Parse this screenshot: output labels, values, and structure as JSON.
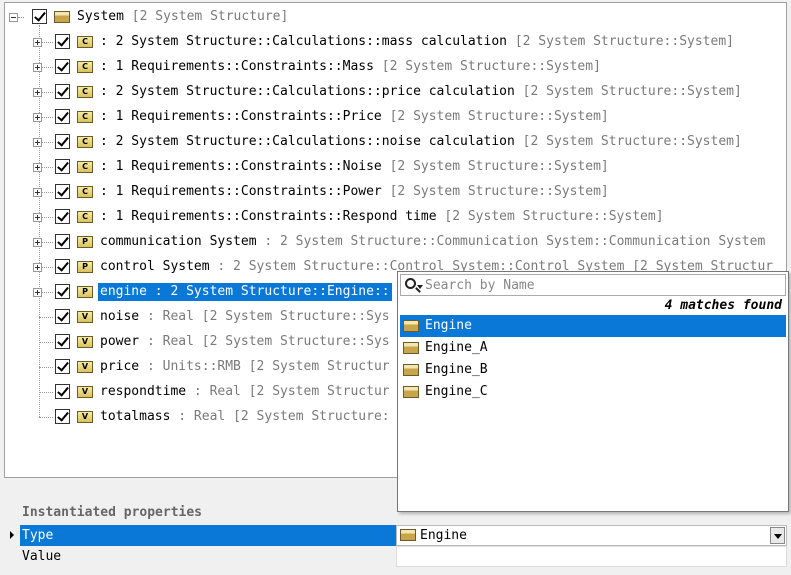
{
  "tree": {
    "root": {
      "name": "System",
      "meta": "[2 System Structure]"
    },
    "items": [
      {
        "icon": "C",
        "name": ": 2 System Structure::Calculations::mass calculation",
        "meta": "[2 System Structure::System]"
      },
      {
        "icon": "C",
        "name": ": 1 Requirements::Constraints::Mass",
        "meta": "[2 System Structure::System]"
      },
      {
        "icon": "C",
        "name": ": 2 System Structure::Calculations::price calculation",
        "meta": "[2 System Structure::System]"
      },
      {
        "icon": "C",
        "name": ": 1 Requirements::Constraints::Price",
        "meta": "[2 System Structure::System]"
      },
      {
        "icon": "C",
        "name": ": 2 System Structure::Calculations::noise calculation",
        "meta": "[2 System Structure::System]"
      },
      {
        "icon": "C",
        "name": ": 1 Requirements::Constraints::Noise",
        "meta": "[2 System Structure::System]"
      },
      {
        "icon": "C",
        "name": ": 1 Requirements::Constraints::Power",
        "meta": "[2 System Structure::System]"
      },
      {
        "icon": "C",
        "name": ": 1 Requirements::Constraints::Respond time",
        "meta": "[2 System Structure::System]"
      },
      {
        "icon": "P",
        "name": "communication System",
        "type": ": 2 System Structure::Communication System::Communication System"
      },
      {
        "icon": "P",
        "name": "control System",
        "type": ": 2 System Structure::Control System::Control System",
        "meta": "[2 System Structur"
      },
      {
        "icon": "P",
        "name": "engine",
        "type": ": 2 System Structure::Engine::",
        "selected": true
      },
      {
        "icon": "V",
        "name": "noise",
        "type": ": Real",
        "meta": "[2 System Structure::Sys"
      },
      {
        "icon": "V",
        "name": "power",
        "type": ": Real",
        "meta": "[2 System Structure::Sys"
      },
      {
        "icon": "V",
        "name": "price",
        "type": ": Units::RMB",
        "meta": "[2 System Structur"
      },
      {
        "icon": "V",
        "name": "respondtime",
        "type": ": Real",
        "meta": "[2 System Structur"
      },
      {
        "icon": "V",
        "name": "totalmass",
        "type": ": Real",
        "meta": "[2 System Structure:"
      }
    ]
  },
  "popup": {
    "search_placeholder": "Search by Name",
    "matches": "4 matches found",
    "results": [
      "Engine",
      "Engine_A",
      "Engine_B",
      "Engine_C"
    ]
  },
  "properties": {
    "title": "Instantiated properties",
    "rows": [
      {
        "name": "Type",
        "value": "Engine"
      },
      {
        "name": "Value",
        "value": ""
      }
    ]
  },
  "colors": {
    "selection": "#0a78d7",
    "meta_text": "#7a7a7a"
  },
  "icons": {
    "scroll_left": "◀"
  }
}
